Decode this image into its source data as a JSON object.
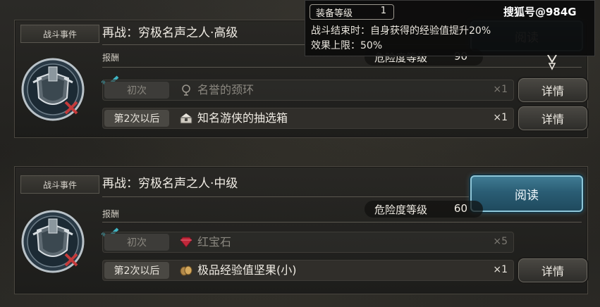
{
  "cards": [
    {
      "tag": "战斗事件",
      "title": "再战：穷极名声之人·高级",
      "reward_label": "报酬",
      "danger": {
        "label": "危险度等级",
        "value": "90"
      },
      "read_button": "阅读",
      "rows": [
        {
          "tag": "初次",
          "item": "名誉的颈环",
          "qty": "×1",
          "icon": "necklace-icon",
          "button": "详情",
          "completed": true
        },
        {
          "tag": "第2次以后",
          "item": "知名游侠的抽选箱",
          "qty": "×1",
          "icon": "chest-icon",
          "button": "详情",
          "completed": false
        }
      ]
    },
    {
      "tag": "战斗事件",
      "title": "再战：穷极名声之人·中级",
      "reward_label": "报酬",
      "danger": {
        "label": "危险度等级",
        "value": "60"
      },
      "read_button": "阅读",
      "rows": [
        {
          "tag": "初次",
          "item": "红宝石",
          "qty": "×5",
          "icon": "ruby-icon",
          "completed": true
        },
        {
          "tag": "第2次以后",
          "item": "极品经验值坚果(小)",
          "qty": "×1",
          "icon": "nut-icon",
          "button": "详情",
          "completed": false
        }
      ]
    }
  ],
  "tooltip": {
    "badge_label": "装备等级",
    "badge_value": "1",
    "line1": "战斗结束时：自身获得的经验值提升20%",
    "line2": "效果上限：50%"
  },
  "watermark": "搜狐号@984G",
  "colors": {
    "check": "#3fb4c4",
    "read_button": "#2a5d74",
    "ruby": "#c0283a"
  }
}
